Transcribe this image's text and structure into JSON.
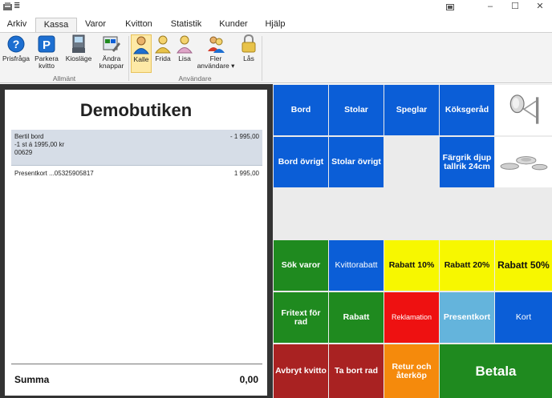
{
  "window": {
    "qat_glyph": "≣",
    "minimize": "–",
    "maximize": "☐",
    "close": "✕"
  },
  "tabs": [
    "Arkiv",
    "Kassa",
    "Varor",
    "Kvitton",
    "Statistik",
    "Kunder",
    "Hjälp"
  ],
  "active_tab": "Kassa",
  "ribbon": {
    "allmant": {
      "label": "Allmänt",
      "buttons": [
        {
          "label": "Prisfråga",
          "icon": "help-icon"
        },
        {
          "label": "Parkera kvitto",
          "icon": "parking-icon"
        },
        {
          "label": "Kiosläge",
          "icon": "kiosk-icon"
        },
        {
          "label": "Ändra knappar",
          "icon": "edit-buttons-icon"
        }
      ]
    },
    "anvandare": {
      "label": "Användare",
      "buttons": [
        {
          "label": "Kalle",
          "icon": "user-icon",
          "selected": true
        },
        {
          "label": "Frida",
          "icon": "user-icon"
        },
        {
          "label": "Lisa",
          "icon": "user-icon"
        },
        {
          "label": "Fler användare",
          "icon": "users-icon",
          "dropdown": "▾"
        },
        {
          "label": "Lås",
          "icon": "lock-icon"
        }
      ]
    }
  },
  "receipt": {
    "store_name": "Demobutiken",
    "items": [
      {
        "name": "Bertil bord",
        "detail": "-1 st á 1995,00 kr",
        "code": "00629",
        "amount": "- 1 995,00",
        "selected": true
      },
      {
        "name": "Presentkort ...05325905817",
        "amount": "1 995,00",
        "selected": false
      }
    ],
    "summa_label": "Summa",
    "summa_value": "0,00"
  },
  "buttons": {
    "bord": "Bord",
    "stolar": "Stolar",
    "speglar": "Speglar",
    "koksgerad": "Köksgeråd",
    "bord_ovrigt": "Bord övrigt",
    "stolar_ovrigt": "Stolar övrigt",
    "fargrik": "Färgrik djup tallrik 24cm",
    "sok_varor": "Sök varor",
    "kvittorabatt": "Kvittorabatt",
    "rabatt10": "Rabatt 10%",
    "rabatt20": "Rabatt 20%",
    "rabatt50": "Rabatt 50%",
    "fritext": "Fritext för rad",
    "rabatt": "Rabatt",
    "reklamation": "Reklamation",
    "presentkort": "Presentkort",
    "kort": "Kort",
    "avbryt": "Avbryt kvitto",
    "ta_bort_rad": "Ta bort rad",
    "retur": "Retur och återköp",
    "betala": "Betala"
  },
  "colors": {
    "blue": "#0b5ed7",
    "green": "#1f8a1f",
    "yellow": "#f7f700",
    "red": "#ee1111",
    "orange": "#f58a0c",
    "darkred": "#a92222",
    "lightblue": "#64b4dc"
  }
}
